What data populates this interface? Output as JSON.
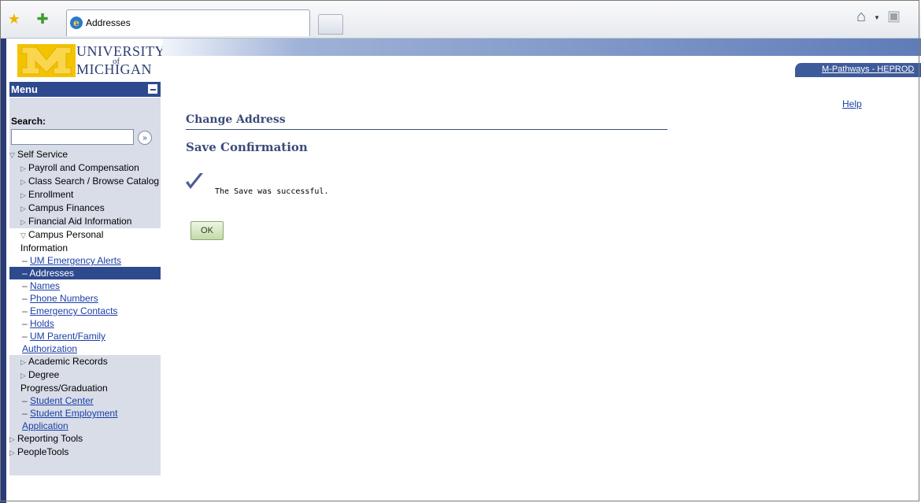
{
  "browser": {
    "tab_title": "Addresses",
    "icons": [
      "favorites-star-icon",
      "add-favorite-icon",
      "ie-icon",
      "home-icon",
      "feeds-icon"
    ]
  },
  "logo": {
    "line1": "UNIVERSITY",
    "of": "of",
    "line2": "MICHIGAN"
  },
  "banner": {
    "product_link": "M-Pathways - HEPROD"
  },
  "sidebar": {
    "menu_title": "Menu",
    "search_label": "Search:",
    "search_value": "",
    "items": [
      {
        "label": "Self Service",
        "level": 0,
        "type": "expanded"
      },
      {
        "label": "Payroll and Compensation",
        "level": 1,
        "type": "collapsed"
      },
      {
        "label": "Class Search / Browse Catalog",
        "level": 1,
        "type": "collapsed"
      },
      {
        "label": "Enrollment",
        "level": 1,
        "type": "collapsed"
      },
      {
        "label": "Campus Finances",
        "level": 1,
        "type": "collapsed"
      },
      {
        "label": "Financial Aid Information",
        "level": 1,
        "type": "collapsed"
      },
      {
        "label": "Campus Personal Information",
        "level": 1,
        "type": "expanded"
      },
      {
        "label": "UM Emergency Alerts",
        "level": 2,
        "type": "link"
      },
      {
        "label": "Addresses",
        "level": 2,
        "type": "selected"
      },
      {
        "label": "Names",
        "level": 2,
        "type": "link"
      },
      {
        "label": "Phone Numbers",
        "level": 2,
        "type": "link"
      },
      {
        "label": "Emergency Contacts",
        "level": 2,
        "type": "link"
      },
      {
        "label": "Holds",
        "level": 2,
        "type": "link"
      },
      {
        "label": "UM Parent/Family Authorization",
        "level": 2,
        "type": "link"
      },
      {
        "label": "Academic Records",
        "level": 1,
        "type": "collapsed"
      },
      {
        "label": "Degree Progress/Graduation",
        "level": 1,
        "type": "collapsed"
      },
      {
        "label": "Student Center",
        "level": 1,
        "type": "link"
      },
      {
        "label": "Student Employment Application",
        "level": 1,
        "type": "link"
      },
      {
        "label": "Reporting Tools",
        "level": 0,
        "type": "collapsed"
      },
      {
        "label": "PeopleTools",
        "level": 0,
        "type": "collapsed"
      }
    ]
  },
  "main": {
    "help_link": "Help",
    "page_title": "Change Address",
    "subtitle": "Save Confirmation",
    "message": "The Save was successful.",
    "ok_label": "OK"
  },
  "colors": {
    "brand_navy": "#2e4a8e",
    "maize": "#f3c300",
    "title_color": "#3b4c79",
    "link_color": "#1b3fa7"
  }
}
